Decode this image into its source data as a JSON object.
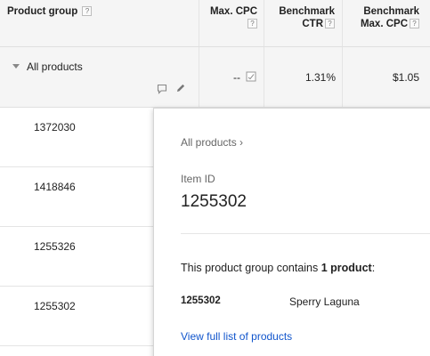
{
  "columns": {
    "product_group": "Product group",
    "max_cpc": "Max. CPC",
    "benchmark_ctr_line1": "Benchmark",
    "benchmark_ctr_line2": "CTR",
    "benchmark_cpc_line1": "Benchmark",
    "benchmark_cpc_line2": "Max. CPC",
    "help_glyph": "?"
  },
  "all_products": {
    "label": "All products",
    "max_cpc": "--",
    "benchmark_ctr": "1.31%",
    "benchmark_cpc": "$1.05"
  },
  "rows": [
    {
      "id": "1372030"
    },
    {
      "id": "1418846"
    },
    {
      "id": "1255326"
    },
    {
      "id": "1255302"
    }
  ],
  "popup": {
    "breadcrumb": "All products ›",
    "item_id_label": "Item ID",
    "item_id_value": "1255302",
    "contains_prefix": "This product group contains ",
    "contains_count": "1 product",
    "contains_suffix": ":",
    "product_id": "1255302",
    "product_name": "Sperry Laguna",
    "view_link": "View full list of products"
  },
  "colors": {
    "header_bg": "#f5f5f5",
    "link": "#1155cc",
    "border": "#e0e0e0"
  }
}
